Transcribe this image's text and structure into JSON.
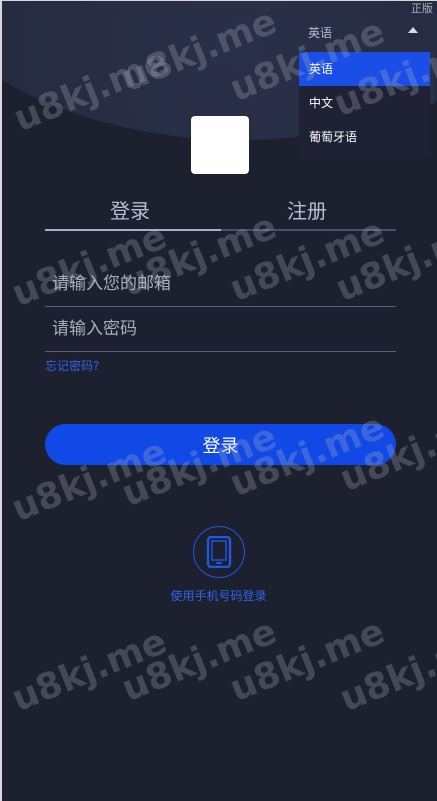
{
  "corner_label": "正版",
  "language": {
    "current": "英语",
    "options": [
      "英语",
      "中文",
      "葡萄牙语"
    ]
  },
  "tabs": {
    "login": "登录",
    "register": "注册"
  },
  "form": {
    "email_placeholder": "请输入您的邮箱",
    "password_placeholder": "请输入密码",
    "forgot_password": "忘记密码?",
    "submit": "登录"
  },
  "alt_login": {
    "icon": "phone-icon",
    "label": "使用手机号码登录"
  },
  "watermark": "u8kj.me",
  "colors": {
    "accent": "#1149e7",
    "background": "#1d212f"
  }
}
